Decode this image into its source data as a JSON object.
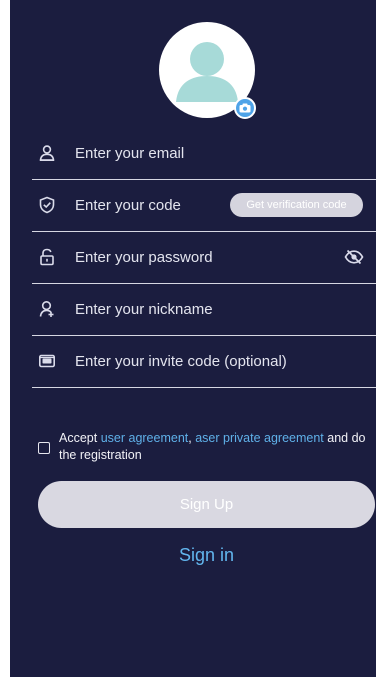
{
  "form": {
    "email": {
      "placeholder": "Enter your email",
      "value": ""
    },
    "code": {
      "placeholder": "Enter your code",
      "value": "",
      "button_label": "Get verification code"
    },
    "password": {
      "placeholder": "Enter your password",
      "value": ""
    },
    "nickname": {
      "placeholder": "Enter your nickname",
      "value": ""
    },
    "invite": {
      "placeholder": "Enter your invite code (optional)",
      "value": ""
    }
  },
  "agreement": {
    "prefix": "Accept",
    "user_agreement": "user agreement",
    "separator": ",",
    "private_agreement": "aser private agreement",
    "suffix": "and do the registration",
    "checked": false
  },
  "actions": {
    "sign_up_label": "Sign Up",
    "sign_in_label": "Sign in"
  },
  "icons": {
    "avatar": "user-avatar-icon",
    "camera": "camera-icon",
    "email": "person-icon",
    "code": "shield-check-icon",
    "password": "lock-icon",
    "password_toggle": "eye-off-icon",
    "nickname": "user-outline-icon",
    "invite": "envelope-icon"
  },
  "colors": {
    "background": "#1b1d3f",
    "text": "#e3e4ee",
    "link": "#5fb0e8",
    "button_disabled": "#d9d8e1",
    "avatar_figure": "#a7dad8",
    "camera_badge": "#4ea3e8"
  }
}
